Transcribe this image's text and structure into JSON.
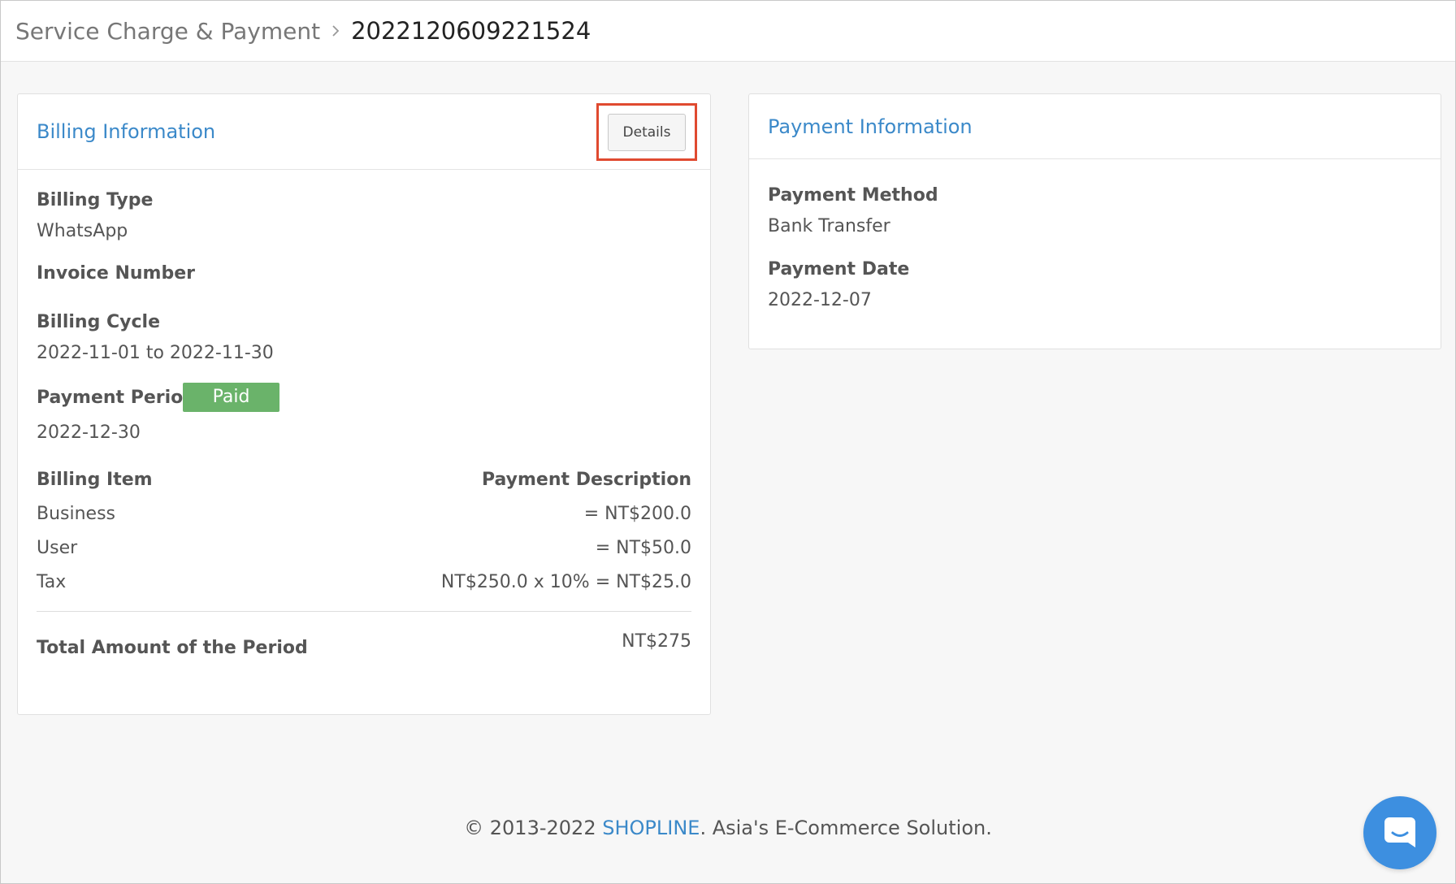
{
  "breadcrumb": {
    "parent": "Service Charge & Payment",
    "current": "2022120609221524"
  },
  "billing": {
    "title": "Billing Information",
    "details_label": "Details",
    "billing_type_label": "Billing Type",
    "billing_type_value": "WhatsApp",
    "invoice_number_label": "Invoice Number",
    "billing_cycle_label": "Billing Cycle",
    "billing_cycle_value": "2022-11-01 to 2022-11-30",
    "payment_period_label": "Payment Period",
    "payment_status": "Paid",
    "payment_period_value": "2022-12-30",
    "items_header": "Billing Item",
    "description_header": "Payment Description",
    "items": [
      {
        "name": "Business",
        "description": "= NT$200.0"
      },
      {
        "name": "User",
        "description": "= NT$50.0"
      },
      {
        "name": "Tax",
        "description": "NT$250.0 x 10% = NT$25.0"
      }
    ],
    "total_label": "Total Amount of the Period",
    "total_value": "NT$275"
  },
  "payment": {
    "title": "Payment Information",
    "method_label": "Payment Method",
    "method_value": "Bank Transfer",
    "date_label": "Payment Date",
    "date_value": "2022-12-07"
  },
  "footer": {
    "prefix": "© 2013-2022 ",
    "brand": "SHOPLINE",
    "suffix": ". Asia's E-Commerce Solution."
  },
  "colors": {
    "accent": "#3b89c9",
    "paid_badge": "#6ab36a",
    "highlight_frame": "#e04a30",
    "chat_button": "#3d8fe0"
  },
  "icons": {
    "breadcrumb_separator": "chevron-right-icon",
    "chat": "chat-bubble-icon"
  }
}
